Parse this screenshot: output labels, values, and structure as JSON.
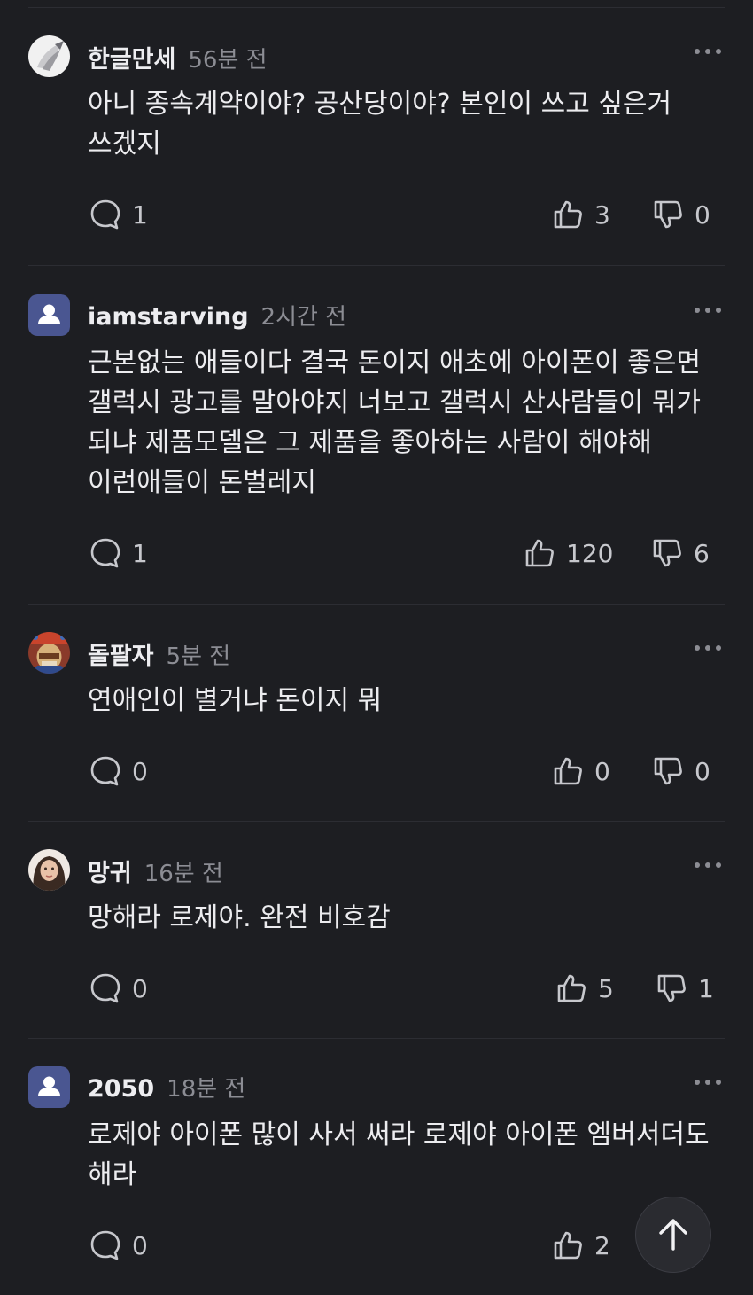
{
  "comments": [
    {
      "username": "한글만세",
      "time": "56분 전",
      "text": "아니 종속계약이야? 공산당이야? 본인이 쓰고 싶은거 쓰겠지",
      "replies": "1",
      "likes": "3",
      "dislikes": "0",
      "avatar": "white-bird-avatar"
    },
    {
      "username": "iamstarving",
      "time": "2시간 전",
      "text": "근본없는 애들이다 결국 돈이지 애초에 아이폰이 좋은면 갤럭시 광고를 말아야지 너보고 갤럭시 산사람들이 뭐가 되냐 제품모델은 그 제품을 좋아하는 사람이 해야해 이런애들이 돈벌레지",
      "replies": "1",
      "likes": "120",
      "dislikes": "6",
      "avatar": "default-user-avatar"
    },
    {
      "username": "돌팔자",
      "time": "5분 전",
      "text": "연애인이 별거냐 돈이지 뭐",
      "replies": "0",
      "likes": "0",
      "dislikes": "0",
      "avatar": "character-avatar"
    },
    {
      "username": "망귀",
      "time": "16분 전",
      "text": "망해라 로제야. 완전 비호감",
      "replies": "0",
      "likes": "5",
      "dislikes": "1",
      "avatar": "portrait-avatar"
    },
    {
      "username": "2050",
      "time": "18분 전",
      "text": "로제야 아이폰 많이 사서 써라 로제야 아이폰 엠버서더도 해라",
      "replies": "0",
      "likes": "2",
      "dislikes": "",
      "avatar": "default-user-avatar"
    }
  ],
  "icons": {
    "reply": "speech-bubble-icon",
    "like": "thumbs-up-icon",
    "dislike": "thumbs-down-icon",
    "more": "more-dots-icon",
    "scroll_top": "arrow-up-icon"
  },
  "colors": {
    "background": "#1d1e22",
    "text": "#ececef",
    "muted": "#8c8d94",
    "default_avatar": "#4a5691"
  }
}
